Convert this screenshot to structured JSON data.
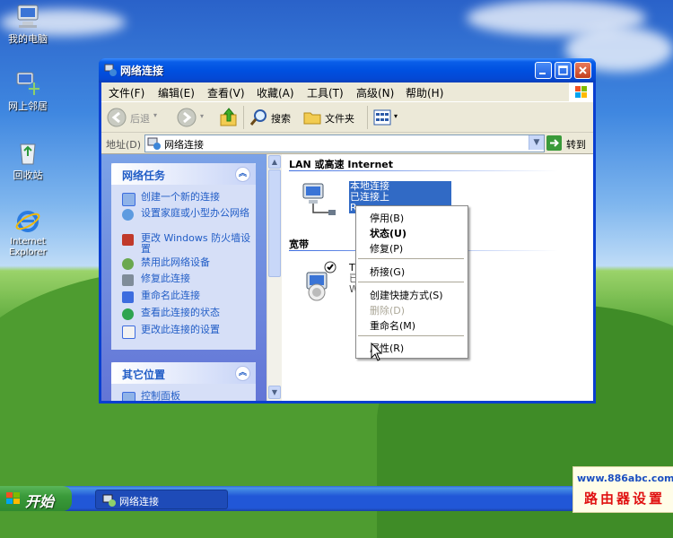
{
  "desktop": {
    "icons": [
      {
        "label": "我的电脑",
        "icon": "my-computer-icon"
      },
      {
        "label": "网上邻居",
        "icon": "network-places-icon"
      },
      {
        "label": "回收站",
        "icon": "recycle-bin-icon"
      },
      {
        "label": "Internet Explorer",
        "icon": "internet-explorer-icon"
      }
    ]
  },
  "window": {
    "title": "网络连接",
    "menu": [
      "文件(F)",
      "编辑(E)",
      "查看(V)",
      "收藏(A)",
      "工具(T)",
      "高级(N)",
      "帮助(H)"
    ],
    "toolbar": {
      "back": "后退",
      "search": "搜索",
      "folders": "文件夹"
    },
    "address": {
      "label": "地址(D)",
      "value": "网络连接",
      "go": "转到"
    }
  },
  "left_pane": {
    "network_tasks": {
      "title": "网络任务",
      "items": [
        "创建一个新的连接",
        "设置家庭或小型办公网络",
        "更改 Windows 防火墙设置",
        "禁用此网络设备",
        "修复此连接",
        "重命名此连接",
        "查看此连接的状态",
        "更改此连接的设置"
      ]
    },
    "other_places": {
      "title": "其它位置",
      "items": [
        "控制面板"
      ]
    }
  },
  "right_pane": {
    "group_lan": "LAN 或高速 Internet",
    "lan_item": {
      "name": "本地连接",
      "status": "已连接上",
      "device": "Rea"
    },
    "group_broadband": "宽带",
    "broadband_item": {
      "name": "TP-",
      "status": "已断",
      "device": "WAN"
    }
  },
  "context_menu": {
    "items": [
      "停用(B)",
      "状态(U)",
      "修复(P)",
      "桥接(G)",
      "创建快捷方式(S)",
      "删除(D)",
      "重命名(M)",
      "属性(R)"
    ],
    "bold_item": "状态(U)",
    "disabled_item": "删除(D)"
  },
  "taskbar": {
    "start": "开始",
    "items": [
      "网络连接"
    ]
  },
  "watermark": {
    "url": "www.886abc.com",
    "text": "路由器设置"
  },
  "colors": {
    "titlebar": "#0050e0",
    "pane_blue": "#215dc6",
    "taskbar": "#2157d7",
    "start_green": "#3a9a3a",
    "watermark_red": "#e01010"
  }
}
